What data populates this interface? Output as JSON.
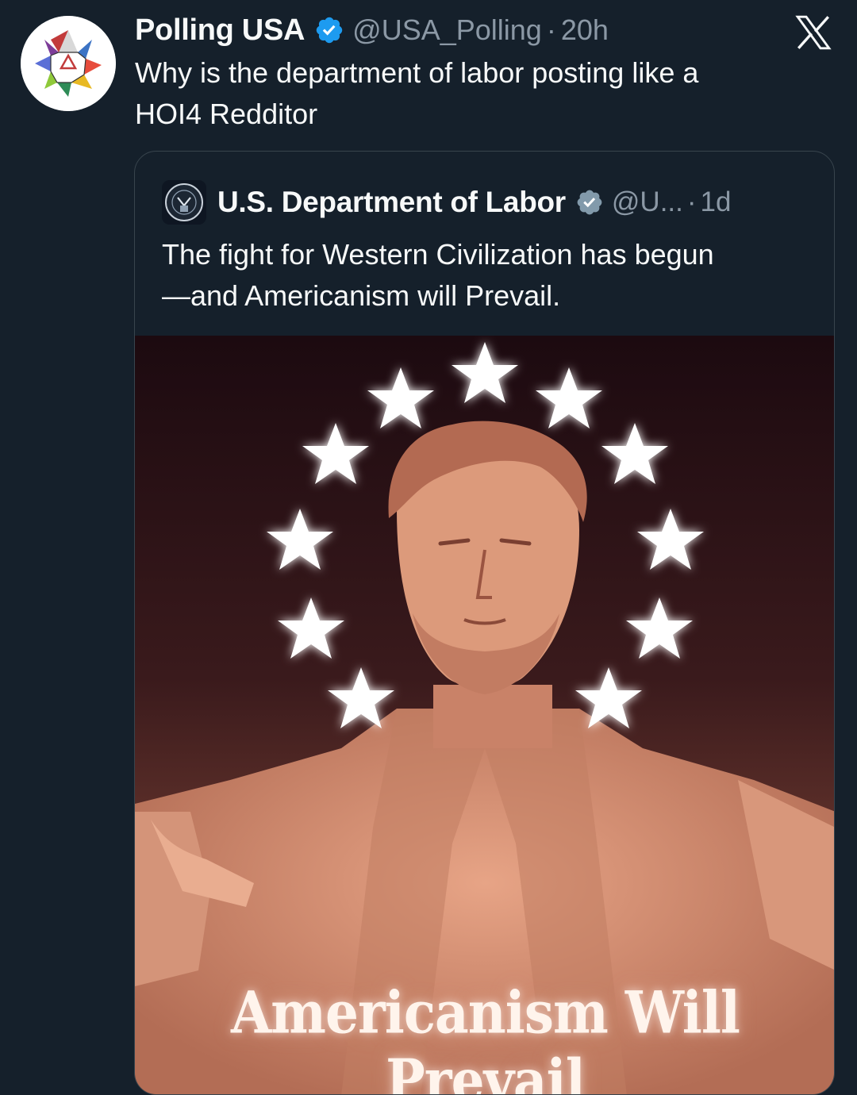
{
  "tweet": {
    "author_name": "Polling USA",
    "handle": "@USA_Polling",
    "separator": "·",
    "time": "20h",
    "text_lines": [
      "Why is the department of labor posting like a",
      "HOI4 Redditor"
    ]
  },
  "quoted_tweet": {
    "author_name": "U.S. Department of Labor",
    "handle": "@U...",
    "separator": "·",
    "time": "1d",
    "text_lines": [
      "The fight for Western Civilization has begun",
      "—and Americanism will Prevail."
    ],
    "image_caption": "Americanism Will Prevail"
  },
  "icons": {
    "verified": "verified-badge-icon",
    "gov_verified": "gov-verified-badge-icon",
    "logo": "x-logo-icon"
  },
  "colors": {
    "background": "#15202b",
    "text": "#f7f9f9",
    "secondary_text": "#8b98a5",
    "verified_blue": "#1d9bf0",
    "gov_badge_gray": "#829aab",
    "border": "#38444d"
  }
}
